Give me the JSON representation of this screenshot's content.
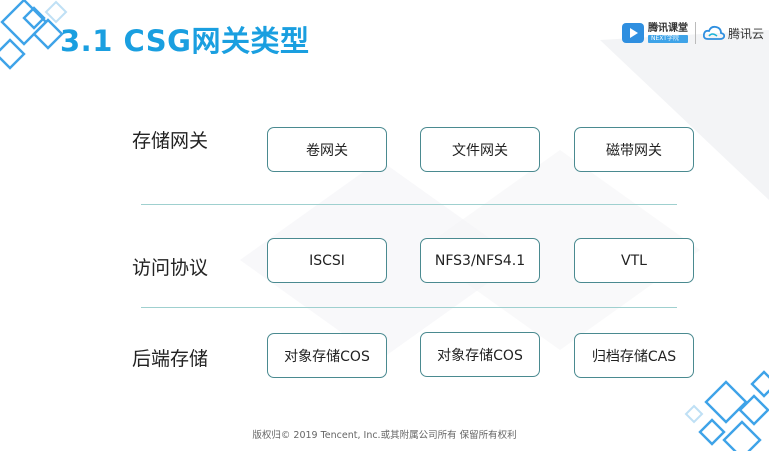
{
  "slide": {
    "title": "3.1 CSG网关类型",
    "logos": {
      "ketang_name": "腾讯课堂",
      "ketang_sub": "NEXT学院",
      "tencent_name": "腾讯云"
    },
    "rows": [
      {
        "label": "存储网关",
        "items": [
          "卷网关",
          "文件网关",
          "磁带网关"
        ]
      },
      {
        "label": "访问协议",
        "items": [
          "ISCSI",
          "NFS3/NFS4.1",
          "VTL"
        ]
      },
      {
        "label": "后端存储",
        "items": [
          "对象存储COS",
          "对象存储COS",
          "归档存储CAS"
        ]
      }
    ],
    "footer": "版权归© 2019 Tencent, Inc.或其附属公司所有 保留所有权利"
  },
  "colors": {
    "title": "#1a9fe0",
    "box_border": "#4a8a90",
    "divider": "#9fd0cf",
    "deco": "#3ea3e8"
  }
}
